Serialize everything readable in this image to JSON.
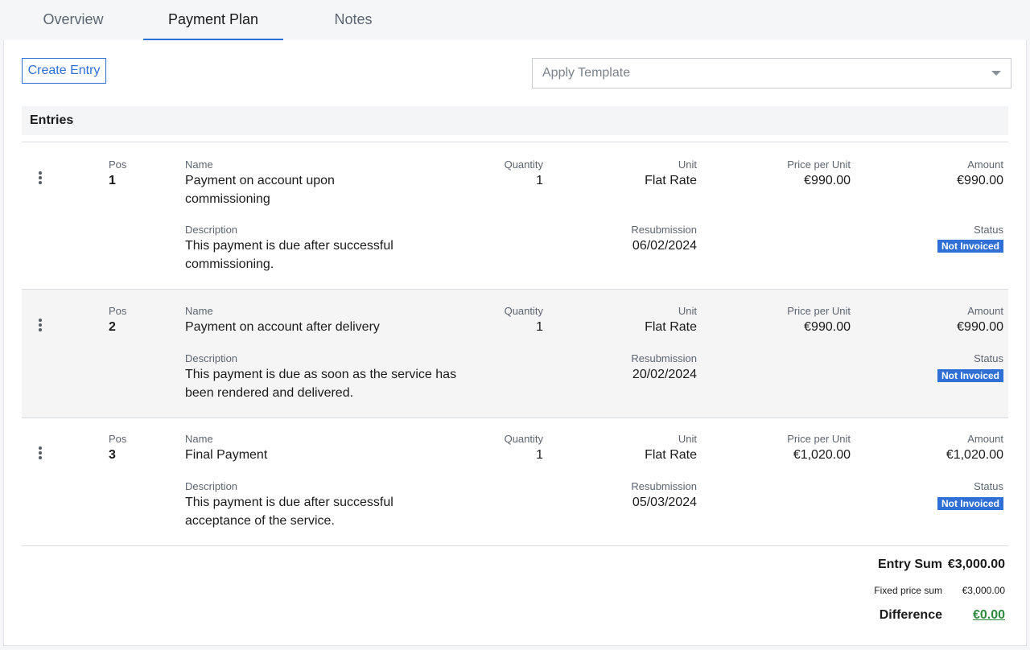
{
  "tabs": [
    {
      "label": "Overview"
    },
    {
      "label": "Payment Plan"
    },
    {
      "label": "Notes"
    }
  ],
  "toolbar": {
    "create_entry_label": "Create Entry",
    "template_placeholder": "Apply Template"
  },
  "entries_title": "Entries",
  "labels": {
    "pos": "Pos",
    "name": "Name",
    "quantity": "Quantity",
    "unit": "Unit",
    "price_per_unit": "Price per Unit",
    "amount": "Amount",
    "description": "Description",
    "resubmission": "Resubmission",
    "status": "Status"
  },
  "entries": [
    {
      "pos": "1",
      "name": "Payment on account upon commissioning",
      "quantity": "1",
      "unit": "Flat Rate",
      "price_per_unit": "€990.00",
      "amount": "€990.00",
      "description": "This payment is due after successful commissioning.",
      "resubmission": "06/02/2024",
      "status": "Not Invoiced"
    },
    {
      "pos": "2",
      "name": "Payment on account after delivery",
      "quantity": "1",
      "unit": "Flat Rate",
      "price_per_unit": "€990.00",
      "amount": "€990.00",
      "description": "This payment is due as soon as the service has been rendered and delivered.",
      "resubmission": "20/02/2024",
      "status": "Not Invoiced"
    },
    {
      "pos": "3",
      "name": "Final Payment",
      "quantity": "1",
      "unit": "Flat Rate",
      "price_per_unit": "€1,020.00",
      "amount": "€1,020.00",
      "description": "This payment is due after successful acceptance of the service.",
      "resubmission": "05/03/2024",
      "status": "Not Invoiced"
    }
  ],
  "summary": {
    "entry_sum_label": "Entry Sum",
    "entry_sum_value": "€3,000.00",
    "fixed_price_label": "Fixed price sum",
    "fixed_price_value": "€3,000.00",
    "difference_label": "Difference",
    "difference_value": "€0.00"
  },
  "colors": {
    "accent": "#2f6fd6",
    "badge": "#2f6fd6",
    "positive": "#2e8b3e"
  }
}
